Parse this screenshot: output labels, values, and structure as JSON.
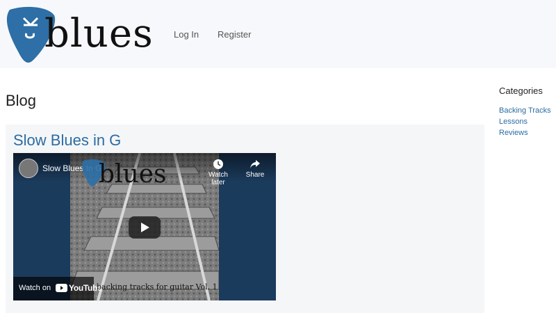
{
  "site": {
    "logo_mark": "CK",
    "logo_word": "blues",
    "brand_color": "#2b6ca3"
  },
  "nav": {
    "login_label": "Log In",
    "register_label": "Register"
  },
  "main": {
    "title": "Blog",
    "post": {
      "title": "Slow Blues in G",
      "video": {
        "title": "Slow Blues In G",
        "overlay_word": "blues",
        "watch_later_label": "Watch later",
        "share_label": "Share",
        "watch_on_label": "Watch on",
        "youtube_label": "YouTube",
        "caption": "backing tracks for guitar Vol. 1"
      }
    }
  },
  "sidebar": {
    "title": "Categories",
    "categories": [
      "Backing Tracks",
      "Lessons",
      "Reviews"
    ]
  }
}
